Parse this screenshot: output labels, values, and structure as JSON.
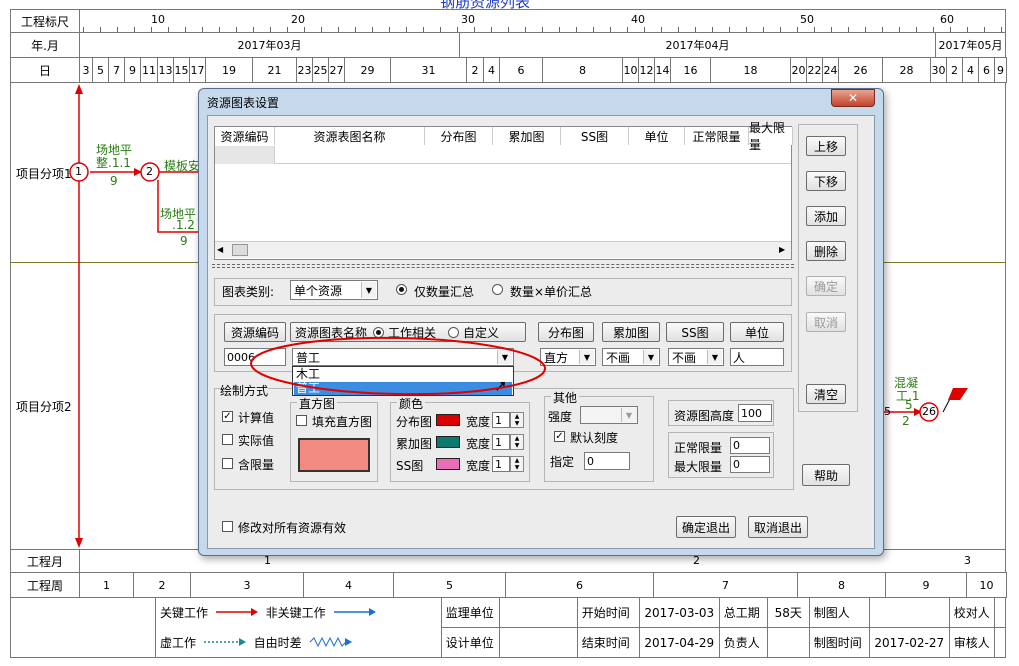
{
  "chart_top_text": "钢筋资源列表",
  "header": {
    "row1_label": "工程标尺",
    "ruler_ticks": [
      "10",
      "20",
      "30",
      "40",
      "50",
      "60"
    ],
    "row2_label": "年.月",
    "months": [
      "2017年03月",
      "2017年04月",
      "2017年05月"
    ],
    "row3_label": "日",
    "days": [
      "3",
      "5",
      "7",
      "9",
      "11",
      "13",
      "15",
      "17",
      "19",
      "21",
      "23",
      "25",
      "27",
      "29",
      "31",
      "2",
      "4",
      "6",
      "8",
      "10",
      "12",
      "14",
      "16",
      "18",
      "20",
      "22",
      "24",
      "26",
      "28",
      "30",
      "2",
      "4",
      "6",
      "9"
    ]
  },
  "rows": {
    "row1_label": "项目分项1",
    "row2_label": "项目分项2"
  },
  "network": {
    "task_a_name": "场地平\n整.1.1",
    "task_a_dur": "9",
    "node1": "1",
    "node2": "2",
    "task_b_name": "模板安",
    "task_c_name": "场地平",
    "task_c_id": ".1.2",
    "task_c_dur": "9",
    "task_d_name": "混凝",
    "task_d_sub": "工.1",
    "task_d_num": "5",
    "node25": "5",
    "node26": "26",
    "node_dur": "2"
  },
  "bottom": {
    "work_month_label": "工程月",
    "work_months": [
      "1",
      "2",
      "3"
    ],
    "work_week_label": "工程周",
    "work_weeks": [
      "1",
      "2",
      "3",
      "4",
      "5",
      "6",
      "7",
      "8",
      "9",
      "10"
    ]
  },
  "legend": {
    "critical": "关键工作",
    "noncritical": "非关键工作",
    "virtual": "虚工作",
    "free_float": "自由时差",
    "supervisor": "监理单位",
    "designer": "设计单位",
    "start_label": "开始时间",
    "start_value": "2017-03-03",
    "end_label": "结束时间",
    "end_value": "2017-04-29",
    "duration_label": "总工期",
    "duration_value": "58天",
    "owner_label": "负责人",
    "drawer_label": "制图人",
    "draw_time_label": "制图时间",
    "draw_time_value": "2017-02-27",
    "checker_label": "校对人",
    "reviewer_label": "审核人"
  },
  "dialog": {
    "title": "资源图表设置",
    "close_icon": "close-icon",
    "table_headers": [
      "资源编码",
      "资源表图名称",
      "分布图",
      "累加图",
      "SS图",
      "单位",
      "正常限量",
      "最大限量"
    ],
    "side_buttons": {
      "up": "上移",
      "down": "下移",
      "add": "添加",
      "delete": "删除",
      "confirm": "确定",
      "cancel": "取消",
      "clear": "清空",
      "help": "帮助"
    },
    "chart_type_label": "图表类别:",
    "chart_type_value": "单个资源",
    "radio_qty": "仅数量汇总",
    "radio_qty_price": "数量×单价汇总",
    "col_code": "资源编码",
    "col_name": "资源图表名称",
    "radio_work": "工作相关",
    "radio_custom": "自定义",
    "col_dist": "分布图",
    "col_accum": "累加图",
    "col_ss": "SS图",
    "col_unit": "单位",
    "code_value": "0006",
    "name_value": "普工",
    "dropdown_options": [
      "木工",
      "普工"
    ],
    "dist_value": "直方",
    "accum_value": "不画",
    "ss_value": "不画",
    "unit_value": "人",
    "draw_mode_title": "绘制方式",
    "opt_calc": "计算值",
    "opt_actual": "实际值",
    "opt_limit": "含限量",
    "hist_title": "直方图",
    "hist_fill": "填充直方图",
    "color_title": "颜色",
    "color_dist": "分布图",
    "color_accum": "累加图",
    "color_ss": "SS图",
    "width_label": "宽度",
    "width_values": [
      "1",
      "1",
      "1"
    ],
    "colors": {
      "dist": "#d80000",
      "accum": "#0d7a6e",
      "ss": "#e86fb6",
      "hist": "#f38a82"
    },
    "other_title": "其他",
    "strength_label": "强度",
    "default_scale": "默认刻度",
    "specify_label": "指定",
    "specify_value": "0",
    "height_label": "资源图高度",
    "height_value": "100",
    "normal_limit_label": "正常限量",
    "normal_limit_value": "0",
    "max_limit_label": "最大限量",
    "max_limit_value": "0",
    "apply_all": "修改对所有资源有效",
    "ok_exit": "确定退出",
    "cancel_exit": "取消退出"
  }
}
